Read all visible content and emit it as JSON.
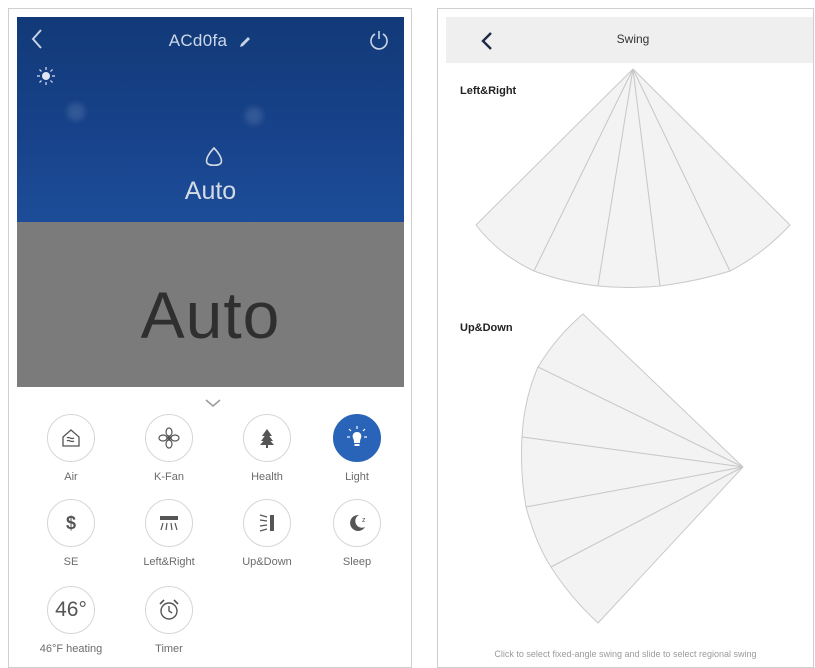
{
  "left_screen": {
    "header": {
      "device_name": "ACd0fa",
      "back_icon": "back-chevron-icon",
      "edit_icon": "pencil-icon",
      "power_icon": "power-icon",
      "light_status_icon": "bulb-icon"
    },
    "hero": {
      "mode_icon": "auto-mode-icon",
      "mode_label": "Auto"
    },
    "big_mode_label": "Auto",
    "expand_icon": "chevron-down-icon",
    "controls": [
      {
        "label": "Air",
        "icon": "air-icon",
        "active": false
      },
      {
        "label": "K-Fan",
        "icon": "fan-icon",
        "active": false
      },
      {
        "label": "Health",
        "icon": "tree-icon",
        "active": false
      },
      {
        "label": "Light",
        "icon": "light-bulb-icon",
        "active": true
      },
      {
        "label": "SE",
        "icon": "dollar-icon",
        "active": false
      },
      {
        "label": "Left&Right",
        "icon": "swing-lr-icon",
        "active": false
      },
      {
        "label": "Up&Down",
        "icon": "swing-ud-icon",
        "active": false
      },
      {
        "label": "Sleep",
        "icon": "moon-icon",
        "active": false
      },
      {
        "label": "46°F heating",
        "value": "46°",
        "active": false
      },
      {
        "label": "Timer",
        "icon": "alarm-clock-icon",
        "active": false
      }
    ]
  },
  "right_screen": {
    "header": {
      "title": "Swing",
      "back_icon": "back-chevron-icon"
    },
    "left_right_label": "Left&Right",
    "up_down_label": "Up&Down",
    "footnote": "Click to select fixed-angle swing and slide to select regional swing"
  },
  "colors": {
    "hero_blue": "#17428a",
    "panel_gray": "#7b7b7b",
    "active_blue": "#2a64b8"
  }
}
